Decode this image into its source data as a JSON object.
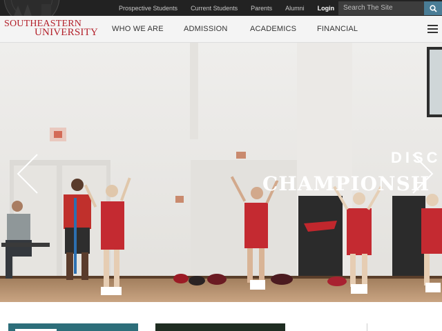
{
  "utility": {
    "links": [
      "Prospective Students",
      "Current Students",
      "Parents",
      "Alumni"
    ],
    "login_label": "Login",
    "search_placeholder": "Search The Site"
  },
  "logo": {
    "line1": "SOUTHEASTERN",
    "line2": "UNIVERSITY"
  },
  "nav": {
    "items": [
      "WHO WE ARE",
      "ADMISSION",
      "ACADEMICS",
      "FINANCIAL"
    ]
  },
  "hero": {
    "line1": "DISC",
    "line2": "CHAMPIONSH",
    "banner_mark": "S"
  },
  "colors": {
    "brand_red": "#b3202a",
    "utility_bg": "#222222",
    "search_accent": "#4a7d96",
    "teal_tile": "#2d6e7a"
  }
}
